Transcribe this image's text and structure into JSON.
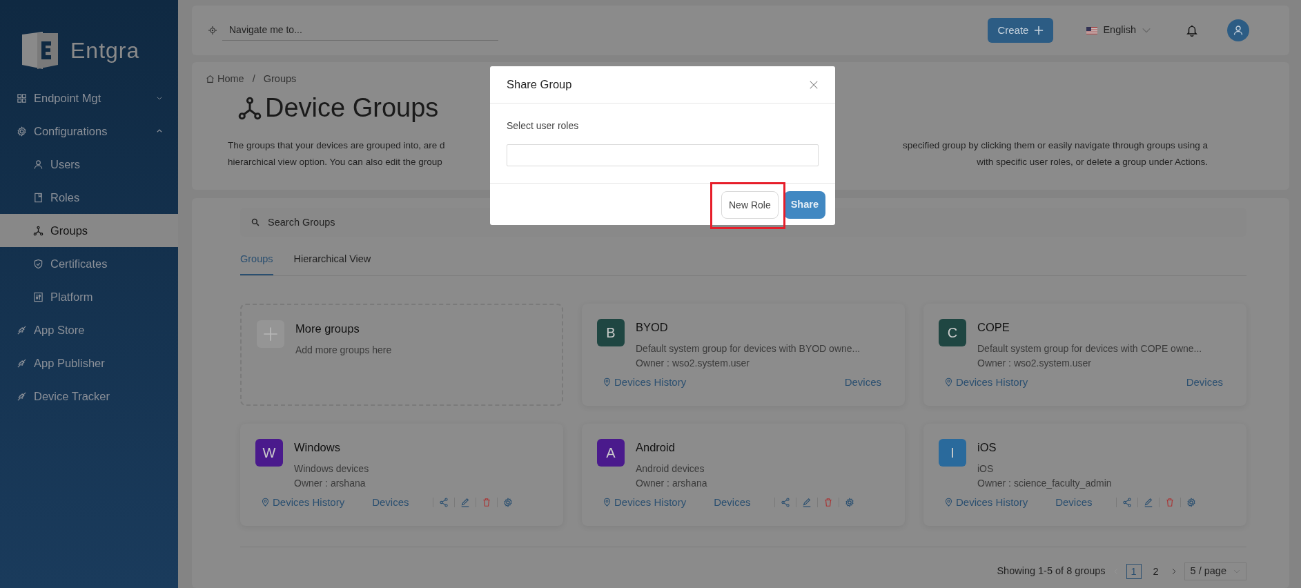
{
  "sidebar": {
    "logo_text": "Entgra",
    "items": [
      {
        "label": "Endpoint Mgt",
        "kind": "group",
        "expanded": false,
        "selected": false
      },
      {
        "label": "Configurations",
        "kind": "group",
        "expanded": true,
        "selected": false,
        "children": [
          {
            "label": "Users",
            "selected": false
          },
          {
            "label": "Roles",
            "selected": false
          },
          {
            "label": "Groups",
            "selected": true
          },
          {
            "label": "Certificates",
            "selected": false
          },
          {
            "label": "Platform",
            "selected": false
          }
        ]
      },
      {
        "label": "App Store",
        "kind": "link",
        "selected": false
      },
      {
        "label": "App Publisher",
        "kind": "link",
        "selected": false
      },
      {
        "label": "Device Tracker",
        "kind": "link",
        "selected": false
      }
    ]
  },
  "top_bar": {
    "search": {
      "placeholder": "Navigate me to..."
    },
    "create_button": "Create",
    "language": "English"
  },
  "header": {
    "breadcrumb": [
      "Home",
      "Groups"
    ],
    "breadcrumb_separator": "/",
    "title": "Device Groups",
    "description_lines": [
      {
        "left": "The groups that your devices are grouped into, are d",
        "right": "specified group by clicking them or easily navigate through groups using a"
      },
      {
        "left": "hierarchical view option. You can also edit the group",
        "right": "with specific user roles, or delete a group under Actions."
      }
    ]
  },
  "search": {
    "placeholder": "Search Groups"
  },
  "tabs": [
    {
      "label": "Groups",
      "selected": true
    },
    {
      "label": "Hierarchical View",
      "selected": false
    }
  ],
  "add_card": {
    "title": "More groups",
    "subtitle": "Add more groups here"
  },
  "groups": [
    {
      "initial": "B",
      "name": "BYOD",
      "description": "Default system group for devices with BYOD owne...",
      "owner": "Owner : wso2.system.user",
      "color": "#1f4642",
      "history": "Devices History",
      "devices": "Devices",
      "actions_shown": false
    },
    {
      "initial": "C",
      "name": "COPE",
      "description": "Default system group for devices with COPE owne...",
      "owner": "Owner : wso2.system.user",
      "color": "#1f4642",
      "history": "Devices History",
      "devices": "Devices",
      "actions_shown": false
    },
    {
      "initial": "W",
      "name": "Windows",
      "description": "Windows devices",
      "owner": "Owner : arshana",
      "color": "#4a1a8c",
      "history": "Devices History",
      "devices": "Devices",
      "actions_shown": true
    },
    {
      "initial": "A",
      "name": "Android",
      "description": "Android devices",
      "owner": "Owner : arshana",
      "color": "#4a1a8c",
      "history": "Devices History",
      "devices": "Devices",
      "actions_shown": true
    },
    {
      "initial": "I",
      "name": "iOS",
      "description": "iOS",
      "owner": "Owner : science_faculty_admin",
      "color": "#2a6a9c",
      "history": "Devices History",
      "devices": "Devices",
      "actions_shown": true
    }
  ],
  "pagination": {
    "summary": "Showing 1-5 of 8 groups",
    "pages": [
      {
        "label": "1",
        "selected": true
      },
      {
        "label": "2",
        "selected": false
      }
    ],
    "page_size": "5 / page"
  },
  "modal": {
    "title": "Share Group",
    "field_label": "Select user roles",
    "buttons": [
      {
        "label": "New Role",
        "kind": "secondary",
        "highlighted": true
      },
      {
        "label": "Share",
        "kind": "primary",
        "highlighted": false
      }
    ]
  }
}
